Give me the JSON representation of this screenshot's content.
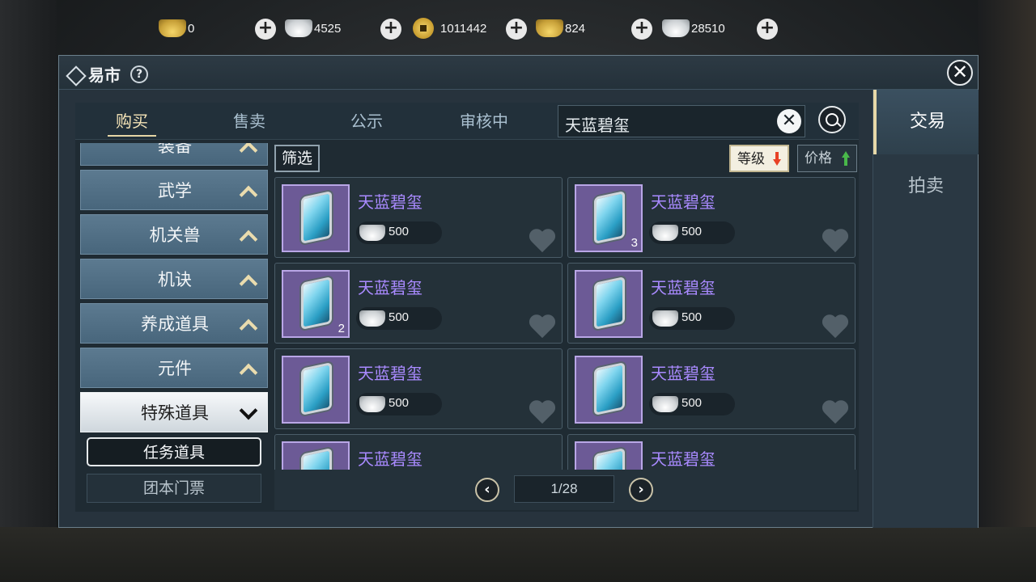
{
  "currencies": [
    {
      "icon": "gold-ingot-icon",
      "value": "0"
    },
    {
      "icon": "silver-ingot-icon",
      "value": "4525"
    },
    {
      "icon": "copper-coin-icon",
      "value": "1011442"
    },
    {
      "icon": "gold-ingot-stamped-icon",
      "value": "824"
    },
    {
      "icon": "silver-ingot-stamped-icon",
      "value": "28510"
    }
  ],
  "window": {
    "title": "易市",
    "help_label": "?",
    "close_label": "✕"
  },
  "side_tabs": [
    {
      "label": "交易",
      "active": true
    },
    {
      "label": "拍卖",
      "active": false
    }
  ],
  "tabs": [
    {
      "label": "购买",
      "active": true
    },
    {
      "label": "售卖",
      "active": false
    },
    {
      "label": "公示",
      "active": false
    },
    {
      "label": "审核中",
      "active": false
    }
  ],
  "search": {
    "value": "天蓝碧玺",
    "clear_label": "✕"
  },
  "categories": [
    {
      "label": "装备",
      "open": false
    },
    {
      "label": "武学",
      "open": false
    },
    {
      "label": "机关兽",
      "open": false
    },
    {
      "label": "机诀",
      "open": false
    },
    {
      "label": "养成道具",
      "open": false
    },
    {
      "label": "元件",
      "open": false
    },
    {
      "label": "特殊道具",
      "open": true
    }
  ],
  "subcategories": [
    {
      "label": "任务道具",
      "active": true
    },
    {
      "label": "团本门票",
      "active": false
    }
  ],
  "filter": {
    "label": "筛选"
  },
  "sort": [
    {
      "label": "等级",
      "direction": "down",
      "active": true,
      "arrow_color": "#e84126"
    },
    {
      "label": "价格",
      "direction": "up",
      "active": false,
      "arrow_color": "#49b84a"
    }
  ],
  "items": [
    {
      "name": "天蓝碧玺",
      "price": "500",
      "count": ""
    },
    {
      "name": "天蓝碧玺",
      "price": "500",
      "count": "3"
    },
    {
      "name": "天蓝碧玺",
      "price": "500",
      "count": "2"
    },
    {
      "name": "天蓝碧玺",
      "price": "500",
      "count": ""
    },
    {
      "name": "天蓝碧玺",
      "price": "500",
      "count": ""
    },
    {
      "name": "天蓝碧玺",
      "price": "500",
      "count": ""
    },
    {
      "name": "天蓝碧玺",
      "price": "",
      "count": ""
    },
    {
      "name": "天蓝碧玺",
      "price": "",
      "count": ""
    }
  ],
  "pagination": {
    "current": "1/28",
    "prev_label": "‹",
    "next_label": "›"
  },
  "colors": {
    "item_name": "#a98aff",
    "active_tab": "#f6e5b8",
    "panel_bg": "#27333d"
  }
}
